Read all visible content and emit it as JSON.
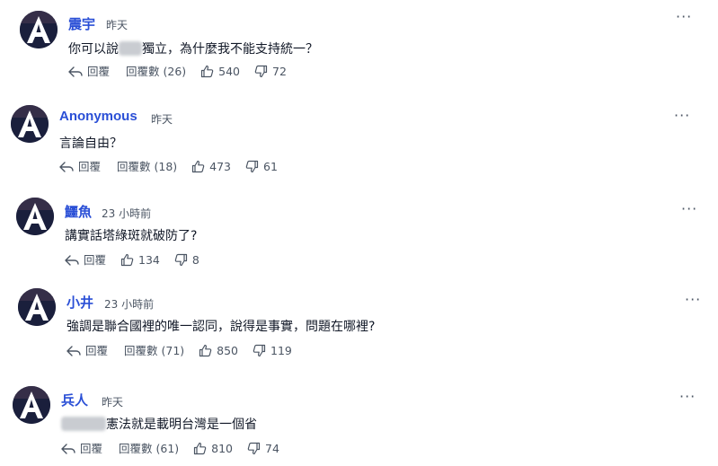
{
  "comments": [
    {
      "name": "震宇",
      "time": "昨天",
      "text_before": "你可以說",
      "text_after": "獨立，為什麼我不能支持統一？",
      "reply": "回覆",
      "replies_label": "回覆數 (26)",
      "likes": "540",
      "dislikes": "72"
    },
    {
      "name": "Anonymous",
      "time": "昨天",
      "text": "言論自由？",
      "reply": "回覆",
      "replies_label": "回覆數 (18)",
      "likes": "473",
      "dislikes": "61"
    },
    {
      "name": "鱷魚",
      "time": "23 小時前",
      "text": "講實話塔綠斑就破防了?",
      "reply": "回覆",
      "likes": "134",
      "dislikes": "8"
    },
    {
      "name": "小井",
      "time": "23 小時前",
      "text": "強調是聯合國裡的唯一認同，說得是事實，問題在哪裡?",
      "reply": "回覆",
      "replies_label": "回覆數 (71)",
      "likes": "850",
      "dislikes": "119"
    },
    {
      "name": "兵人",
      "time": "昨天",
      "text_after": "憲法就是載明台灣是一個省",
      "reply": "回覆",
      "replies_label": "回覆數 (61)",
      "likes": "810",
      "dislikes": "74"
    }
  ],
  "icons": {
    "more": "more-dots-icon",
    "reply": "reply-arrow-icon",
    "like": "thumbs-up-icon",
    "dislike": "thumbs-down-icon"
  },
  "colors": {
    "name": "#2a4fd6",
    "avatar_bg": "#1a1f3c",
    "avatar_letter": "#ffffff"
  }
}
